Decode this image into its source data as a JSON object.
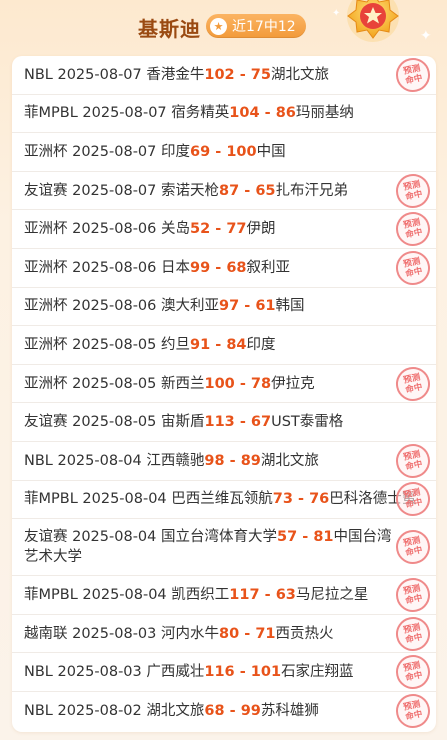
{
  "header": {
    "title": "基斯迪",
    "record": "近17中12",
    "badge_icon": "trophy-medal-icon"
  },
  "stamp_text": {
    "line1": "预测",
    "line2": "命中"
  },
  "colors": {
    "score": "#e8531a",
    "accent": "#f29a3a",
    "title": "#9a4a12"
  },
  "matches": [
    {
      "league": "NBL",
      "date": "2025-08-07",
      "home": "香港金牛",
      "home_score": "102",
      "sep": " - ",
      "away_score": "75",
      "away": "湖北文旅",
      "hit": true
    },
    {
      "league": "菲MPBL",
      "date": "2025-08-07",
      "home": "宿务精英",
      "home_score": "104",
      "sep": " - ",
      "away_score": "86",
      "away": "玛丽基纳",
      "hit": false
    },
    {
      "league": "亚洲杯",
      "date": "2025-08-07",
      "home": "印度",
      "home_score": "69",
      "sep": " - ",
      "away_score": "100",
      "away": "中国",
      "hit": false
    },
    {
      "league": "友谊赛",
      "date": "2025-08-07",
      "home": "索诺天枪",
      "home_score": "87",
      "sep": " - ",
      "away_score": "65",
      "away": "扎布汗兄弟",
      "hit": true
    },
    {
      "league": "亚洲杯",
      "date": "2025-08-06",
      "home": "关岛",
      "home_score": "52",
      "sep": " - ",
      "away_score": "77",
      "away": "伊朗",
      "hit": true
    },
    {
      "league": "亚洲杯",
      "date": "2025-08-06",
      "home": "日本",
      "home_score": "99",
      "sep": " - ",
      "away_score": "68",
      "away": "叙利亚",
      "hit": true
    },
    {
      "league": "亚洲杯",
      "date": "2025-08-06",
      "home": "澳大利亚",
      "home_score": "97",
      "sep": " - ",
      "away_score": "61",
      "away": "韩国",
      "hit": false
    },
    {
      "league": "亚洲杯",
      "date": "2025-08-05",
      "home": "约旦",
      "home_score": "91",
      "sep": " - ",
      "away_score": "84",
      "away": "印度",
      "hit": false
    },
    {
      "league": "亚洲杯",
      "date": "2025-08-05",
      "home": "新西兰",
      "home_score": "100",
      "sep": " - ",
      "away_score": "78",
      "away": "伊拉克",
      "hit": true
    },
    {
      "league": "友谊赛",
      "date": "2025-08-05",
      "home": "宙斯盾",
      "home_score": "113",
      "sep": " - ",
      "away_score": "67",
      "away": "UST泰雷格",
      "hit": false
    },
    {
      "league": "NBL",
      "date": "2025-08-04",
      "home": "江西赣驰",
      "home_score": "98",
      "sep": " - ",
      "away_score": "89",
      "away": "湖北文旅",
      "hit": true
    },
    {
      "league": "菲MPBL",
      "date": "2025-08-04",
      "home": "巴西兰维瓦领航",
      "home_score": "73",
      "sep": " - ",
      "away_score": "76",
      "away": "巴科洛德士蜜",
      "hit": true
    },
    {
      "league": "友谊赛",
      "date": "2025-08-04",
      "home": "国立台湾体育大学",
      "home_score": "57",
      "sep": " - ",
      "away_score": "81",
      "away": "中国台湾艺术大学",
      "hit": true,
      "tall": true
    },
    {
      "league": "菲MPBL",
      "date": "2025-08-04",
      "home": "凯西织工",
      "home_score": "117",
      "sep": " - ",
      "away_score": "63",
      "away": "马尼拉之星",
      "hit": true
    },
    {
      "league": "越南联",
      "date": "2025-08-03",
      "home": "河内水牛",
      "home_score": "80",
      "sep": " - ",
      "away_score": "71",
      "away": "西贡热火",
      "hit": true
    },
    {
      "league": "NBL",
      "date": "2025-08-03",
      "home": "广西威壮",
      "home_score": "116",
      "sep": " - ",
      "away_score": "101",
      "away": "石家庄翔蓝",
      "hit": true
    },
    {
      "league": "NBL",
      "date": "2025-08-02",
      "home": "湖北文旅",
      "home_score": "68",
      "sep": " - ",
      "away_score": "99",
      "away": "苏科雄狮",
      "hit": true
    }
  ]
}
